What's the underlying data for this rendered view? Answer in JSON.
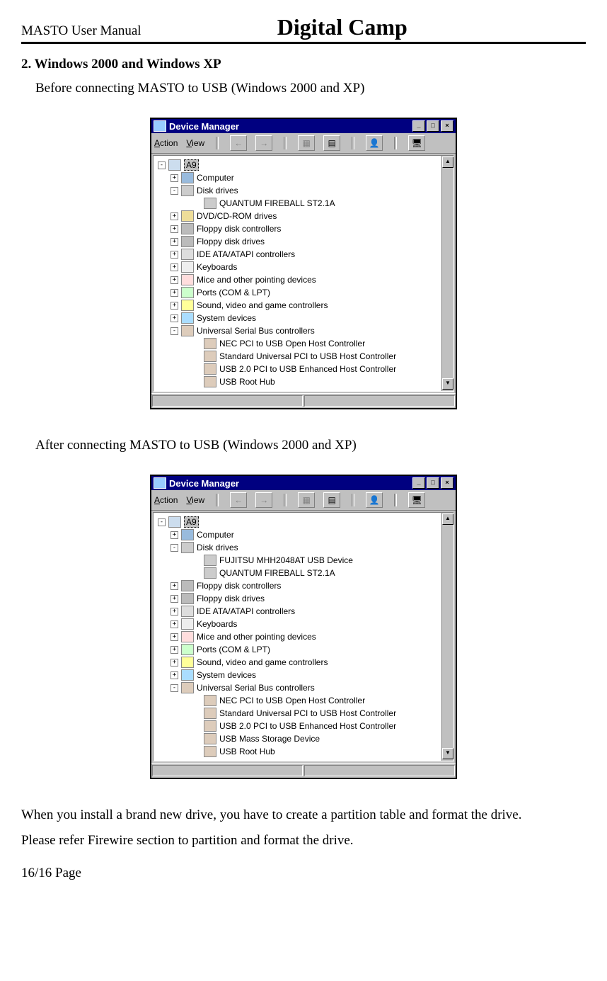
{
  "header": {
    "left": "MASTO User Manual",
    "title": "Digital Camp"
  },
  "section_heading": "2. Windows 2000 and Windows XP",
  "before_text": "Before connecting MASTO to USB (Windows 2000 and XP)",
  "after_text": "After connecting MASTO to USB (Windows 2000 and XP)",
  "footer_text_1": "When you install a brand new drive, you have to create a partition table and format the drive.",
  "footer_text_2": "Please refer Firewire section to partition and format the drive.",
  "page_number": "16/16 Page",
  "dm": {
    "title": "Device Manager",
    "menu_action": "Action",
    "menu_view": "View",
    "root_label": "A9"
  },
  "tree_before": {
    "root": "A9",
    "items": [
      {
        "exp": "+",
        "icon": "monitor",
        "label": "Computer",
        "indent": 1
      },
      {
        "exp": "-",
        "icon": "disk",
        "label": "Disk drives",
        "indent": 1
      },
      {
        "exp": "",
        "icon": "disk",
        "label": "QUANTUM FIREBALL ST2.1A",
        "indent": 2
      },
      {
        "exp": "+",
        "icon": "cd",
        "label": "DVD/CD-ROM drives",
        "indent": 1
      },
      {
        "exp": "+",
        "icon": "floppy",
        "label": "Floppy disk controllers",
        "indent": 1
      },
      {
        "exp": "+",
        "icon": "floppy",
        "label": "Floppy disk drives",
        "indent": 1
      },
      {
        "exp": "+",
        "icon": "ide",
        "label": "IDE ATA/ATAPI controllers",
        "indent": 1
      },
      {
        "exp": "+",
        "icon": "kb",
        "label": "Keyboards",
        "indent": 1
      },
      {
        "exp": "+",
        "icon": "mouse",
        "label": "Mice and other pointing devices",
        "indent": 1
      },
      {
        "exp": "+",
        "icon": "port",
        "label": "Ports (COM & LPT)",
        "indent": 1
      },
      {
        "exp": "+",
        "icon": "sound",
        "label": "Sound, video and game controllers",
        "indent": 1
      },
      {
        "exp": "+",
        "icon": "sys",
        "label": "System devices",
        "indent": 1
      },
      {
        "exp": "-",
        "icon": "usb",
        "label": "Universal Serial Bus controllers",
        "indent": 1
      },
      {
        "exp": "",
        "icon": "usb",
        "label": "NEC PCI to USB Open Host Controller",
        "indent": 2
      },
      {
        "exp": "",
        "icon": "usb",
        "label": "Standard Universal PCI to USB Host Controller",
        "indent": 2
      },
      {
        "exp": "",
        "icon": "usb",
        "label": "USB 2.0 PCI to USB Enhanced Host Controller",
        "indent": 2
      },
      {
        "exp": "",
        "icon": "usb",
        "label": "USB Root Hub",
        "indent": 2
      }
    ]
  },
  "tree_after": {
    "root": "A9",
    "items": [
      {
        "exp": "+",
        "icon": "monitor",
        "label": "Computer",
        "indent": 1
      },
      {
        "exp": "-",
        "icon": "disk",
        "label": "Disk drives",
        "indent": 1
      },
      {
        "exp": "",
        "icon": "disk",
        "label": "FUJITSU MHH2048AT USB Device",
        "indent": 2
      },
      {
        "exp": "",
        "icon": "disk",
        "label": "QUANTUM FIREBALL ST2.1A",
        "indent": 2
      },
      {
        "exp": "+",
        "icon": "floppy",
        "label": "Floppy disk controllers",
        "indent": 1
      },
      {
        "exp": "+",
        "icon": "floppy",
        "label": "Floppy disk drives",
        "indent": 1
      },
      {
        "exp": "+",
        "icon": "ide",
        "label": "IDE ATA/ATAPI controllers",
        "indent": 1
      },
      {
        "exp": "+",
        "icon": "kb",
        "label": "Keyboards",
        "indent": 1
      },
      {
        "exp": "+",
        "icon": "mouse",
        "label": "Mice and other pointing devices",
        "indent": 1
      },
      {
        "exp": "+",
        "icon": "port",
        "label": "Ports (COM & LPT)",
        "indent": 1
      },
      {
        "exp": "+",
        "icon": "sound",
        "label": "Sound, video and game controllers",
        "indent": 1
      },
      {
        "exp": "+",
        "icon": "sys",
        "label": "System devices",
        "indent": 1
      },
      {
        "exp": "-",
        "icon": "usb",
        "label": "Universal Serial Bus controllers",
        "indent": 1
      },
      {
        "exp": "",
        "icon": "usb",
        "label": "NEC PCI to USB Open Host Controller",
        "indent": 2
      },
      {
        "exp": "",
        "icon": "usb",
        "label": "Standard Universal PCI to USB Host Controller",
        "indent": 2
      },
      {
        "exp": "",
        "icon": "usb",
        "label": "USB 2.0 PCI to USB Enhanced Host Controller",
        "indent": 2
      },
      {
        "exp": "",
        "icon": "usb",
        "label": "USB Mass Storage Device",
        "indent": 2
      },
      {
        "exp": "",
        "icon": "usb",
        "label": "USB Root Hub",
        "indent": 2
      }
    ]
  }
}
